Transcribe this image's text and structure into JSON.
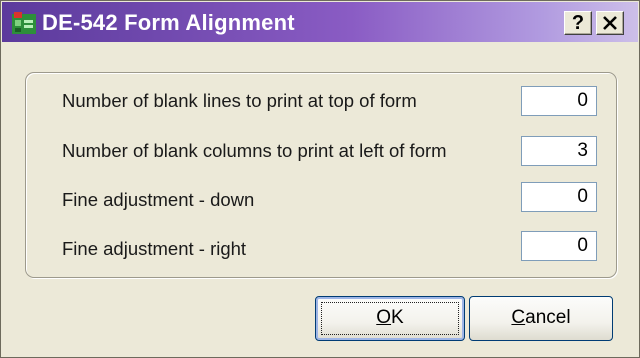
{
  "window": {
    "title": "DE-542 Form Alignment",
    "help_label": "?",
    "close_label": "✕"
  },
  "fields": [
    {
      "label": "Number of blank lines to print at top of form",
      "value": "0"
    },
    {
      "label": "Number of blank columns to print at left of form",
      "value": "3"
    },
    {
      "label": "Fine adjustment - down",
      "value": "0"
    },
    {
      "label": "Fine adjustment - right",
      "value": "0"
    }
  ],
  "buttons": {
    "ok_mnemonic": "O",
    "ok_rest": "K",
    "cancel_mnemonic": "C",
    "cancel_rest": "ancel"
  }
}
